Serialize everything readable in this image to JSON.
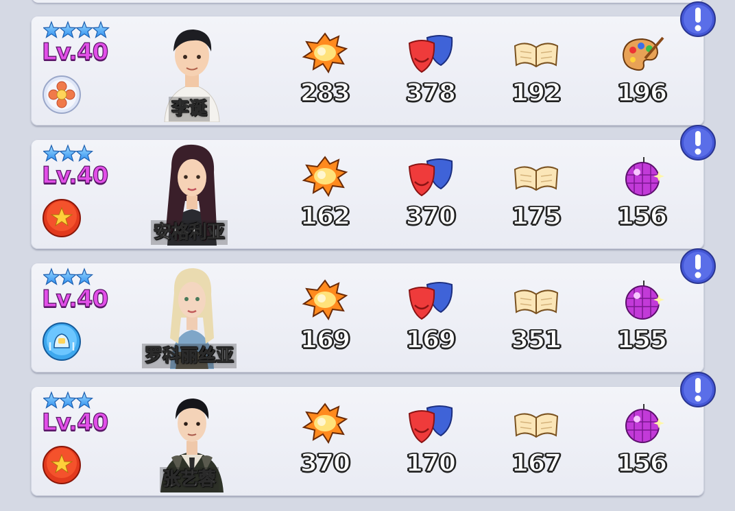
{
  "characters": [
    {
      "stars": 4,
      "level": "Lv.40",
      "badge": "flower-badge-icon",
      "name": "李诞",
      "avatar": "male-white-shirt",
      "stats": {
        "explosive": "283",
        "drama": "378",
        "knowledge": "192",
        "fourth": "196"
      },
      "fourth_icon": "palette-icon"
    },
    {
      "stars": 3,
      "level": "Lv.40",
      "badge": "red-star-badge-icon",
      "name": "安格利亚",
      "avatar": "female-dark-hair",
      "stats": {
        "explosive": "162",
        "drama": "370",
        "knowledge": "175",
        "fourth": "156"
      },
      "fourth_icon": "disco-ball-icon"
    },
    {
      "stars": 3,
      "level": "Lv.40",
      "badge": "blue-bell-badge-icon",
      "name": "罗科丽丝亚",
      "avatar": "female-blonde",
      "stats": {
        "explosive": "169",
        "drama": "169",
        "knowledge": "351",
        "fourth": "155"
      },
      "fourth_icon": "disco-ball-icon"
    },
    {
      "stars": 3,
      "level": "Lv.40",
      "badge": "red-star-badge-icon",
      "name": "张艺蓉",
      "avatar": "male-military-coat",
      "stats": {
        "explosive": "370",
        "drama": "170",
        "knowledge": "167",
        "fourth": "156"
      },
      "fourth_icon": "disco-ball-icon"
    }
  ],
  "colors": {
    "level_text": "#e24fe8",
    "star_blue": "#4aa8ff",
    "alert_blue": "#4457d6",
    "card_bg": "#eef0f6"
  }
}
